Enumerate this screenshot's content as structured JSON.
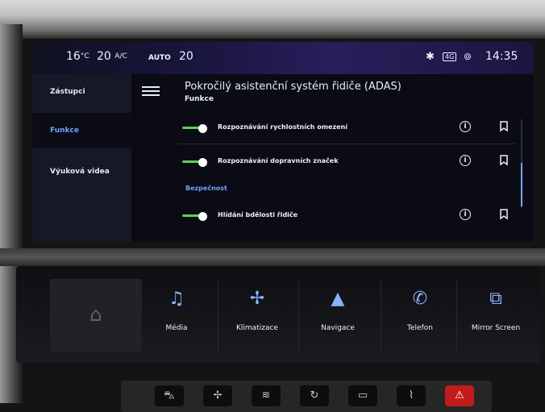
{
  "status_bar": {
    "temp_left": "16",
    "temp_left_unit": "°C",
    "fan_value": "20",
    "ac_label": "A/C",
    "auto_label": "AUTO",
    "temp_right": "20",
    "bluetooth_icon": "bluetooth-icon",
    "network_label": "4G",
    "location_icon": "location-icon",
    "time": "14:35"
  },
  "sidebar": {
    "items": [
      {
        "label": "Zástupci",
        "selected": false
      },
      {
        "label": "Funkce",
        "selected": true
      },
      {
        "label": "Výuková videa",
        "selected": false
      }
    ]
  },
  "main": {
    "title": "Pokročilý asistenční systém řidiče (ADAS)",
    "subtitle": "Funkce",
    "section_safety": "Bezpečnost",
    "rows": [
      {
        "label": "Rozpoznávání rychlostních omezení",
        "enabled": true
      },
      {
        "label": "Rozpoznávání dopravních značek",
        "enabled": true
      },
      {
        "label": "Hlídání bdělosti řidiče",
        "enabled": true
      }
    ]
  },
  "shortcuts": {
    "home_icon": "home-icon",
    "media": "Média",
    "climate": "Klimatizace",
    "navigation": "Navigace",
    "phone": "Telefon",
    "mirror": "Mirror Screen"
  },
  "colors": {
    "accent_blue": "#6fa3ff",
    "toggle_green": "#5ad35a",
    "hazard_red": "#c21b1b"
  }
}
